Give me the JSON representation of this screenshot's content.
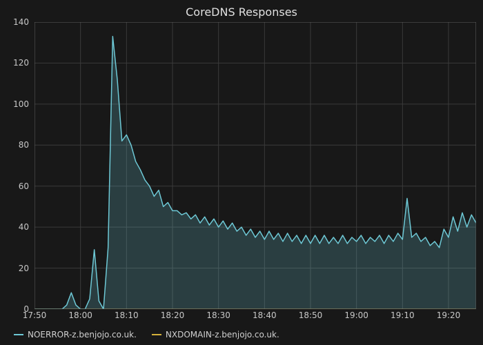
{
  "chart_data": {
    "type": "area",
    "title": "CoreDNS Responses",
    "xlabel": "",
    "ylabel": "",
    "ylim": [
      0,
      140
    ],
    "xlim_minutes": [
      1070,
      1166
    ],
    "y_ticks": [
      0,
      20,
      40,
      60,
      80,
      100,
      120,
      140
    ],
    "x_ticks": [
      "17:50",
      "18:00",
      "18:10",
      "18:20",
      "18:30",
      "18:40",
      "18:50",
      "19:00",
      "19:10",
      "19:20"
    ],
    "grid": true,
    "legend_position": "bottom-left",
    "series": [
      {
        "name": "NOERROR-z.benjojo.co.uk.",
        "color": "#6ec9d6",
        "fill": "rgba(110,201,214,0.22)",
        "x_minutes": [
          1070,
          1076,
          1077,
          1078,
          1079,
          1080,
          1081,
          1082,
          1083,
          1084,
          1085,
          1086,
          1087,
          1088,
          1089,
          1090,
          1091,
          1092,
          1093,
          1094,
          1095,
          1096,
          1097,
          1098,
          1099,
          1100,
          1101,
          1102,
          1103,
          1104,
          1105,
          1106,
          1107,
          1108,
          1109,
          1110,
          1111,
          1112,
          1113,
          1114,
          1115,
          1116,
          1117,
          1118,
          1119,
          1120,
          1121,
          1122,
          1123,
          1124,
          1125,
          1126,
          1127,
          1128,
          1129,
          1130,
          1131,
          1132,
          1133,
          1134,
          1135,
          1136,
          1137,
          1138,
          1139,
          1140,
          1141,
          1142,
          1143,
          1144,
          1145,
          1146,
          1147,
          1148,
          1149,
          1150,
          1151,
          1152,
          1153,
          1154,
          1155,
          1156,
          1157,
          1158,
          1159,
          1160,
          1161,
          1162,
          1163,
          1164,
          1165,
          1166
        ],
        "values": [
          0,
          0,
          2,
          8,
          2,
          0,
          0,
          5,
          29,
          4,
          0,
          30,
          133,
          112,
          82,
          85,
          80,
          72,
          68,
          63,
          60,
          55,
          58,
          50,
          52,
          48,
          48,
          46,
          47,
          44,
          46,
          42,
          45,
          41,
          44,
          40,
          43,
          39,
          42,
          38,
          40,
          36,
          39,
          35,
          38,
          34,
          38,
          34,
          37,
          33,
          37,
          33,
          36,
          32,
          36,
          32,
          36,
          32,
          36,
          32,
          35,
          32,
          36,
          32,
          35,
          33,
          36,
          32,
          35,
          33,
          36,
          32,
          36,
          33,
          37,
          34,
          54,
          35,
          37,
          33,
          35,
          31,
          33,
          30,
          39,
          35,
          45,
          38,
          47,
          40,
          46,
          42
        ]
      },
      {
        "name": "NXDOMAIN-z.benjojo.co.uk.",
        "color": "#d6b23a",
        "fill": "rgba(214,178,58,0.25)",
        "x_minutes": [
          1070,
          1166
        ],
        "values": [
          0,
          0
        ]
      }
    ]
  }
}
